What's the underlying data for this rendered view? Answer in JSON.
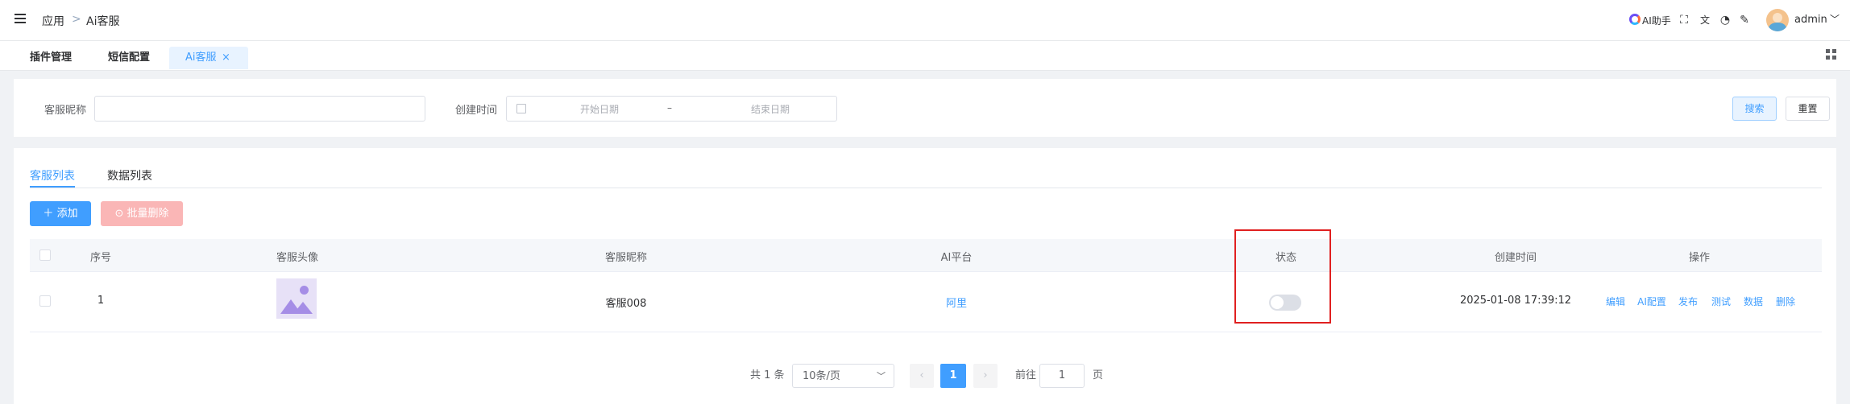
{
  "header": {
    "breadcrumb": [
      "应用",
      ">",
      "Ai客服"
    ],
    "ai_assistant": "AI助手",
    "user": "admin"
  },
  "tabs": [
    {
      "label": "插件管理"
    },
    {
      "label": "短信配置"
    },
    {
      "label": "Ai客服",
      "close": "×"
    }
  ],
  "search": {
    "nickname_label": "客服昵称",
    "nickname_value": "",
    "time_label": "创建时间",
    "start_placeholder": "开始日期",
    "range_sep": "–",
    "end_placeholder": "结束日期",
    "search_button": "搜索",
    "reset_button": "重置"
  },
  "content_tabs": [
    "客服列表",
    "数据列表"
  ],
  "actions": {
    "add": "添加",
    "batch_delete": "批量删除"
  },
  "table": {
    "headers": [
      "序号",
      "客服头像",
      "客服昵称",
      "AI平台",
      "状态",
      "创建时间",
      "操作"
    ],
    "rows": [
      {
        "index": "1",
        "nickname": "客服008",
        "platform": "阿里",
        "status": false,
        "created": "2025-01-08 17:39:12",
        "ops": [
          "编辑",
          "AI配置",
          "发布",
          "测试",
          "数据",
          "删除"
        ]
      }
    ]
  },
  "pagination": {
    "total": "共 1 条",
    "page_size": "10条/页",
    "current_page": "1",
    "goto_label": "前往",
    "goto_value": "1",
    "page_suffix": "页"
  },
  "colors": {
    "primary": "#409eff",
    "danger_light": "#fab6b6",
    "highlight": "#e02020"
  }
}
